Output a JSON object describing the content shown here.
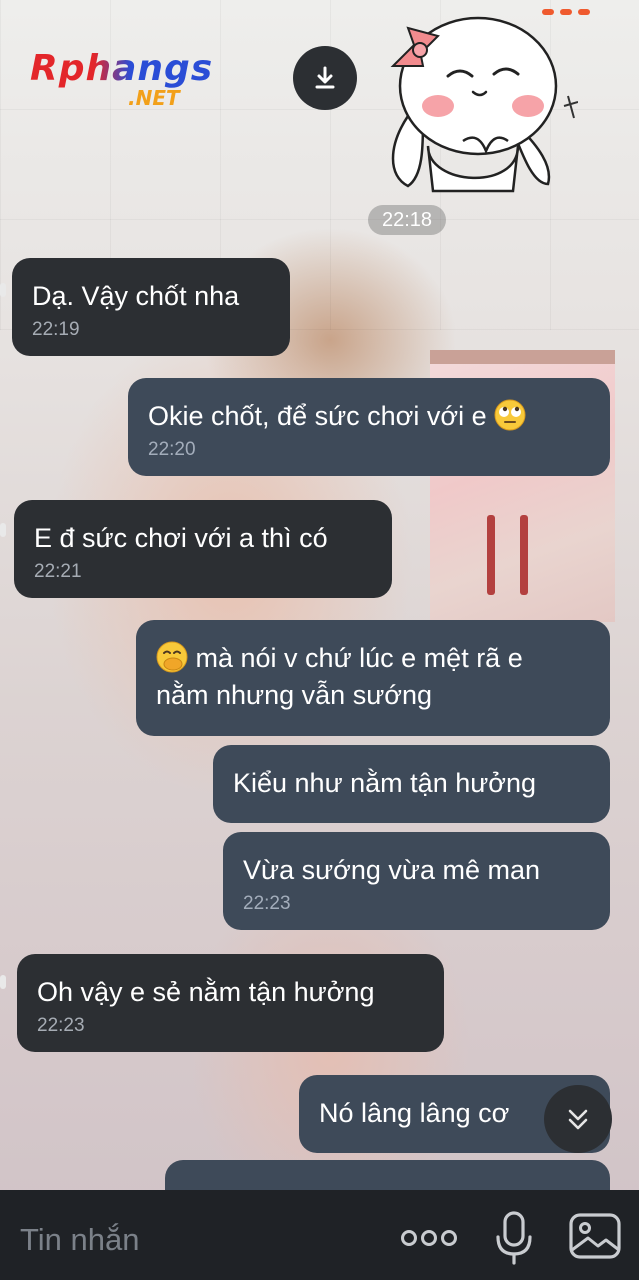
{
  "watermark": {
    "main": "Rphangs",
    "sub": ".NET"
  },
  "header": {
    "download_icon": "download-icon",
    "sticker": "bunny-sticker"
  },
  "date_pill": "22:18",
  "messages": [
    {
      "dir": "in",
      "text": "Dạ. Vậy chốt nha",
      "time": "22:19"
    },
    {
      "dir": "out",
      "text": "Okie chốt, để sức chơi với e",
      "emoji": "face-rolling-eyes",
      "time": "22:20"
    },
    {
      "dir": "in",
      "text": "E đ sức chơi với a thì có",
      "time": "22:21"
    },
    {
      "dir": "out",
      "emoji": "face-hand-over-mouth",
      "line1": "mà nói v chứ lúc e mệt rã e",
      "line2": "nằm nhưng vẫn sướng"
    },
    {
      "dir": "out",
      "text": "Kiểu như nằm tận hưởng"
    },
    {
      "dir": "out",
      "text": "Vừa sướng vừa mê man",
      "time": "22:23"
    },
    {
      "dir": "in",
      "text": "Oh vậy e sẻ nằm tận hưởng",
      "time": "22:23"
    },
    {
      "dir": "out",
      "text": "Nó lâng lâng cơ"
    }
  ],
  "composer": {
    "placeholder": "Tin nhắn",
    "more_icon": "more-icon",
    "mic_icon": "microphone-icon",
    "image_icon": "image-icon"
  },
  "scroll_button_icon": "double-chevron-down-icon",
  "colors": {
    "incoming_bubble": "#2c2f33",
    "outgoing_bubble": "#3e4a59",
    "composer_bg": "#1f2226"
  }
}
